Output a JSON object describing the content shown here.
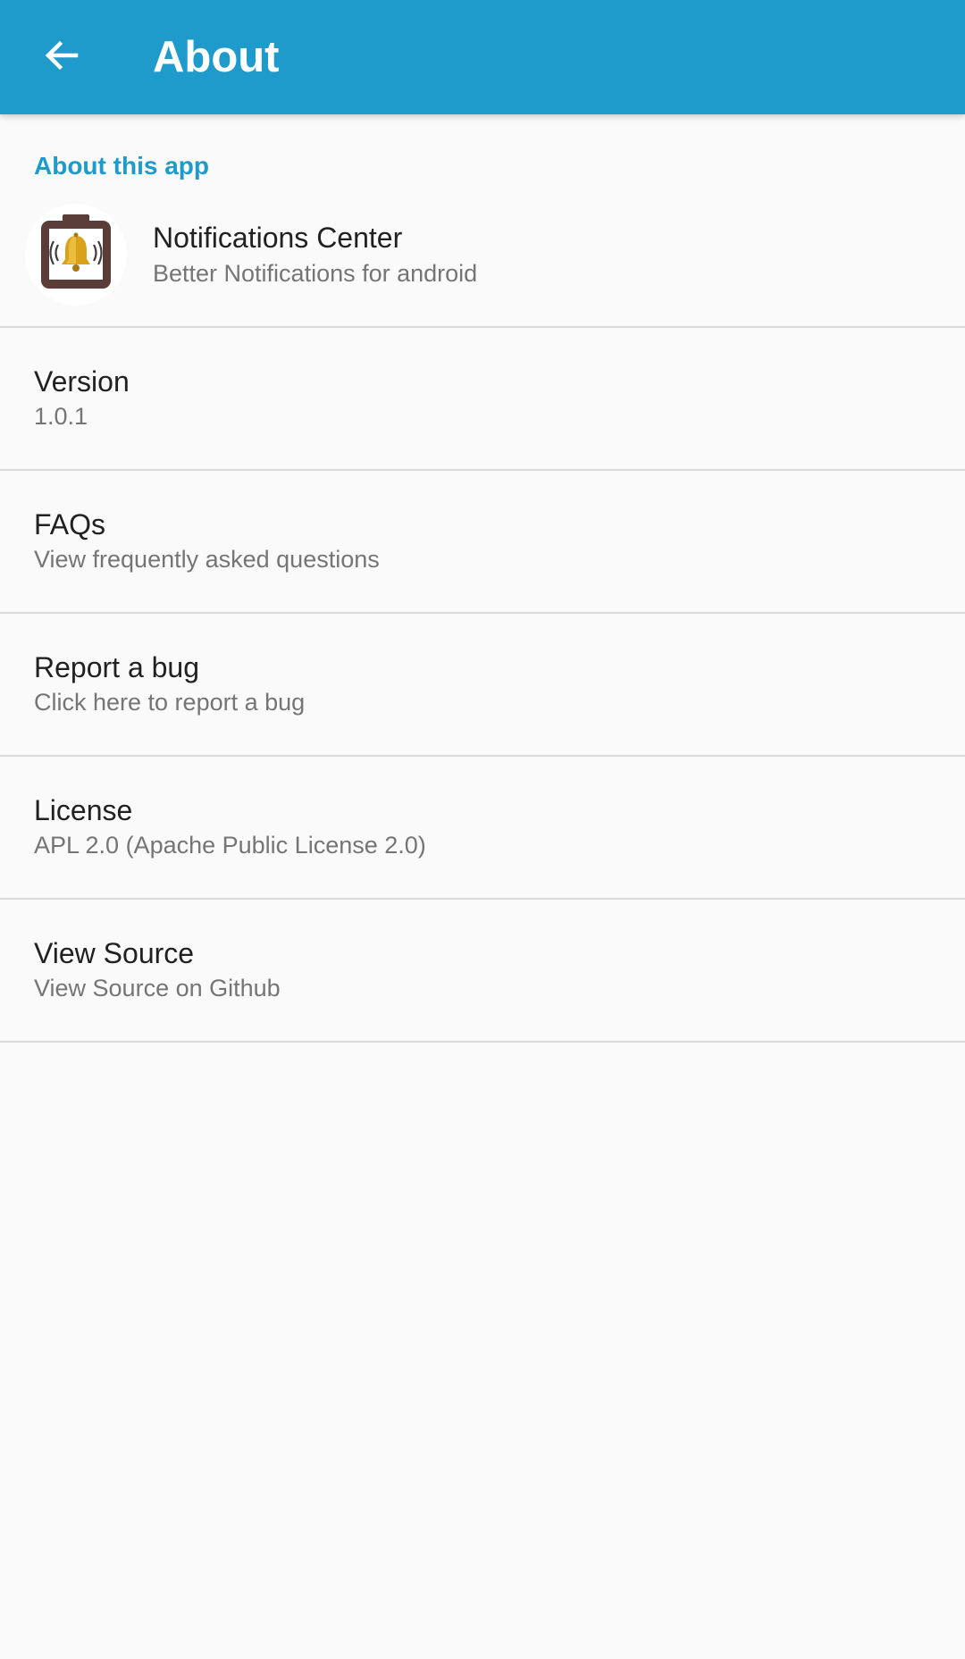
{
  "app_bar": {
    "title": "About",
    "back_icon": "arrow-back-icon"
  },
  "section": {
    "header": "About this app"
  },
  "app_info": {
    "name": "Notifications Center",
    "tagline": "Better Notifications for android",
    "icon": "bell-app-icon"
  },
  "items": [
    {
      "title": "Version",
      "summary": "1.0.1"
    },
    {
      "title": "FAQs",
      "summary": "View frequently asked questions"
    },
    {
      "title": "Report a bug",
      "summary": "Click here to report a bug"
    },
    {
      "title": "License",
      "summary": "APL 2.0 (Apache Public License 2.0)"
    },
    {
      "title": "View Source",
      "summary": "View Source on Github"
    }
  ],
  "colors": {
    "primary": "#1e9bcb",
    "background": "#fafafa",
    "divider": "#d9d9d9"
  }
}
